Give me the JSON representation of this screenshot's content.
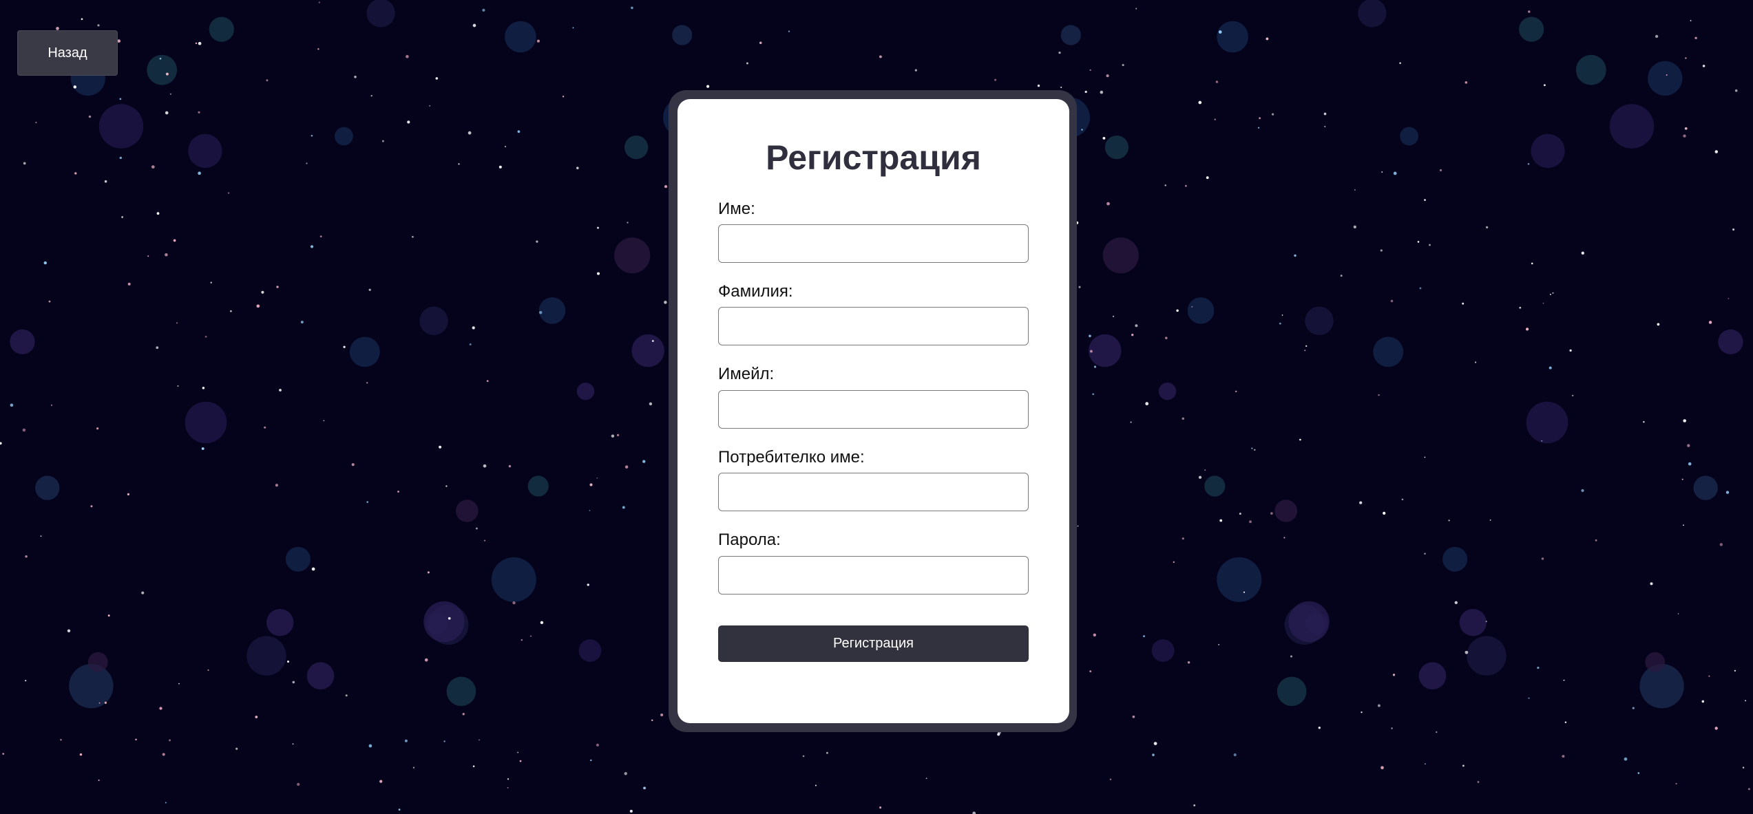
{
  "header": {
    "back_label": "Назад"
  },
  "form": {
    "title": "Регистрация",
    "fields": [
      {
        "label": "Име:",
        "value": "",
        "placeholder": ""
      },
      {
        "label": "Фамилия:",
        "value": "",
        "placeholder": ""
      },
      {
        "label": "Имейл:",
        "value": "",
        "placeholder": ""
      },
      {
        "label": "Потребителко име:",
        "value": "",
        "placeholder": ""
      },
      {
        "label": "Парола:",
        "value": "",
        "placeholder": ""
      }
    ],
    "submit_label": "Регистрация"
  },
  "colors": {
    "background": "#05031c",
    "card": "#ffffff",
    "card_frame": "#353445",
    "button": "#32323f",
    "back_button": "#3a3a47",
    "title_text": "#2f2f3e"
  }
}
